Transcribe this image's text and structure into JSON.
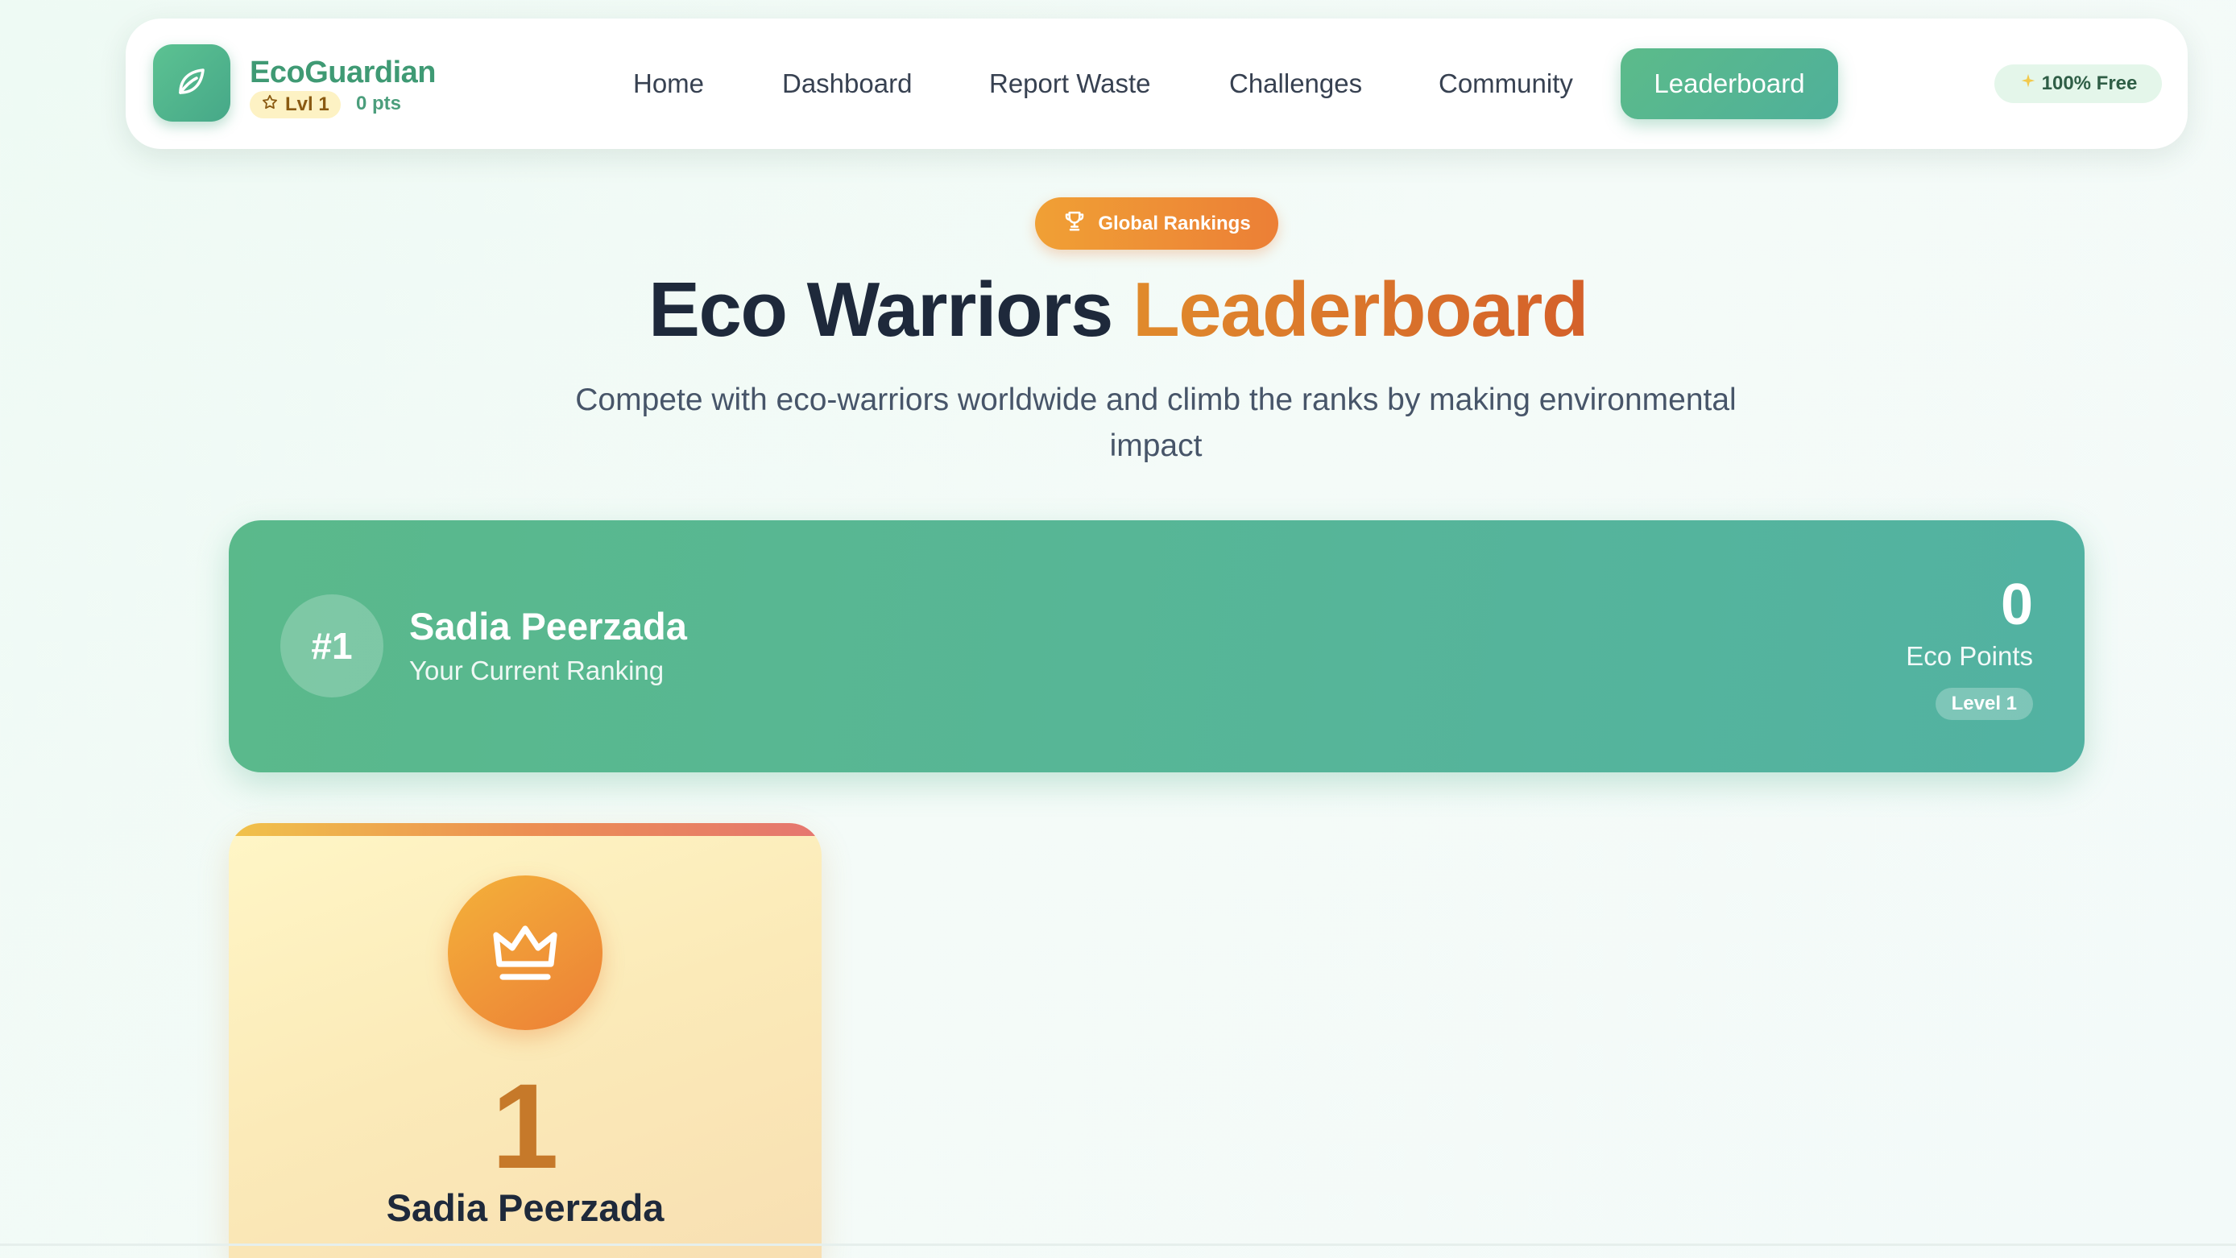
{
  "header": {
    "brand": "EcoGuardian",
    "level_label": "Lvl 1",
    "points_label": "0 pts",
    "nav": [
      {
        "label": "Home"
      },
      {
        "label": "Dashboard"
      },
      {
        "label": "Report Waste"
      },
      {
        "label": "Challenges"
      },
      {
        "label": "Community"
      },
      {
        "label": "Leaderboard",
        "active": true
      }
    ],
    "free_badge": "100% Free"
  },
  "hero": {
    "pill": "Global Rankings",
    "title_main": "Eco Warriors",
    "title_accent": "Leaderboard",
    "subtitle": "Compete with eco-warriors worldwide and climb the ranks by making environmental impact"
  },
  "current_ranking": {
    "rank": "#1",
    "name": "Sadia Peerzada",
    "label": "Your Current Ranking",
    "points": "0",
    "points_label": "Eco Points",
    "level": "Level 1"
  },
  "top_player": {
    "rank": "1",
    "name": "Sadia Peerzada"
  },
  "icons": {
    "logo": "leaf-icon",
    "level": "star-icon",
    "free": "sparkle-icon",
    "pill": "trophy-icon",
    "top": "crown-icon"
  },
  "colors": {
    "brand_green": "#4fb08a",
    "accent_orange": "#ec7f36",
    "text_dark": "#1e293b"
  }
}
